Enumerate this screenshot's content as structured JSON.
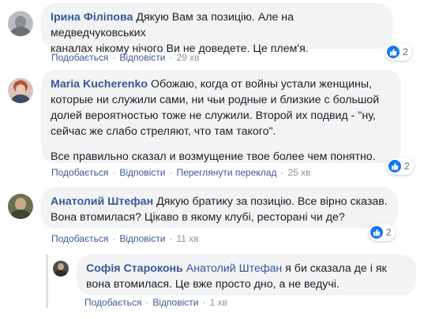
{
  "colors": {
    "link": "#385898",
    "meta": "#90949c",
    "bubble": "#f2f3f5",
    "like": "#1877f2"
  },
  "comments": [
    {
      "author": "Ірина Філіпова",
      "text_lines": [
        "Дякую Вам за позицію. Але на медведчуковських",
        "каналах нікому нічого Ви не доведете. Це плем'я."
      ],
      "like_label": "Подобається",
      "reply_label": "Відповісти",
      "time": "29 хв",
      "reactions": "2"
    },
    {
      "author": "Maria Kucherenko",
      "text_lines": [
        "Обожаю, когда от войны устали женщины,",
        "которые ни служили сами, ни чьи родные и близкие с большой",
        "долей вероятностью тоже не служили. Второй их подвид - \"ну,",
        "сейчас же слабо стреляют, что там такого\"."
      ],
      "text_para2": "Все правильно сказал и возмущение твое более чем понятно.",
      "like_label": "Подобається",
      "reply_label": "Відповісти",
      "translate_label": "Переглянути переклад",
      "time": "25 хв",
      "reactions": "2"
    },
    {
      "author": "Анатолий Штефан",
      "text_lines": [
        "Дякую братику за позицію. Все вірно сказав.",
        "Вона втомилася? Цікаво в якому клубі, ресторані чи де?"
      ],
      "like_label": "Подобається",
      "reply_label": "Відповісти",
      "time": "11 хв",
      "reactions": "2"
    }
  ],
  "reply": {
    "author": "Софія Староконь",
    "mention": "Анатолий Штефан",
    "text_line1": "я би сказала де і як",
    "text_line2": "вона втомилася. Це вже просто дно, а не ведучі.",
    "like_label": "Подобається",
    "reply_label": "Відповісти",
    "time": "1 хв"
  }
}
